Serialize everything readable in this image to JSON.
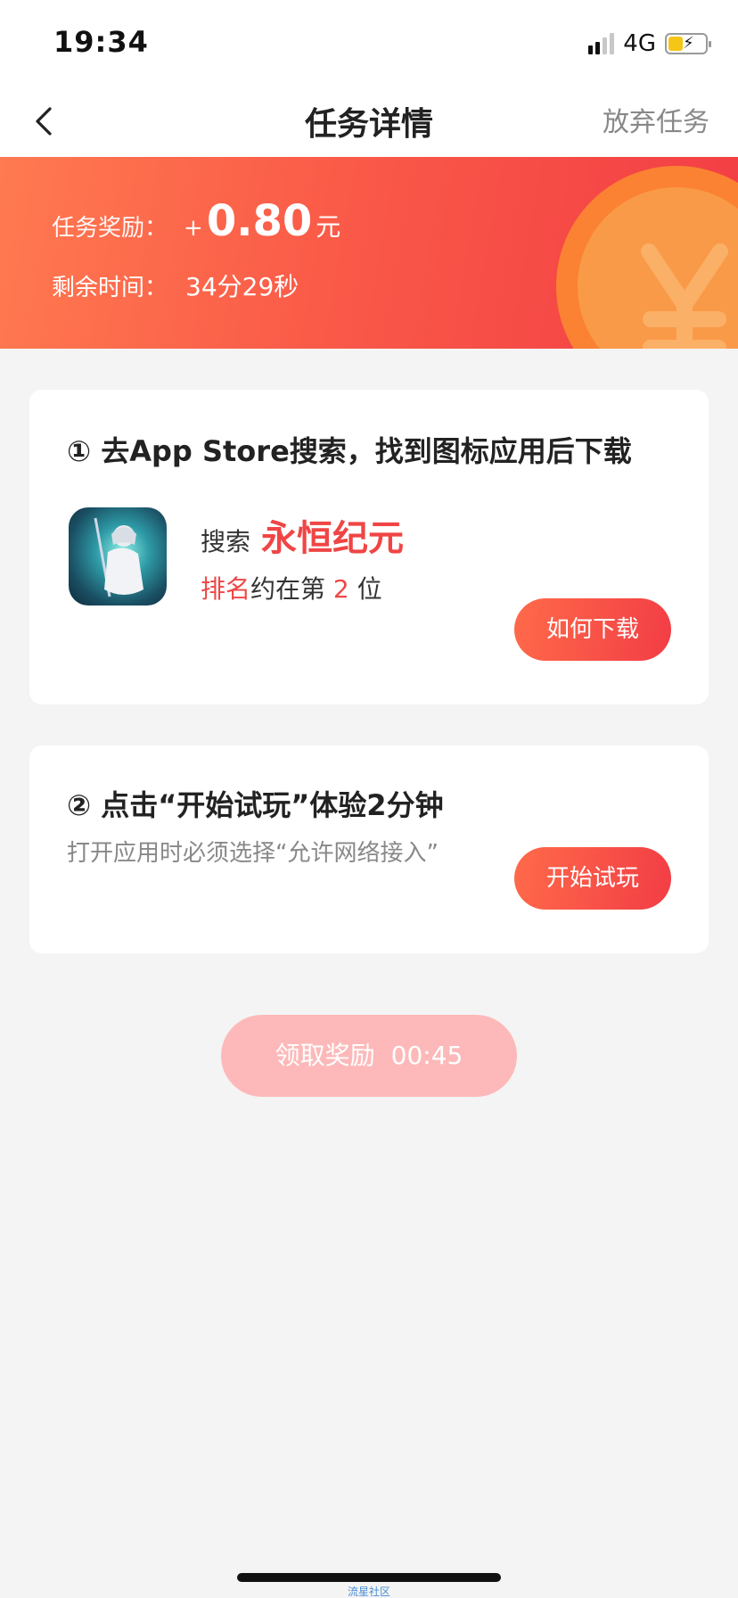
{
  "status_bar": {
    "time": "19:34",
    "network": "4G",
    "battery_color": "#f5c518"
  },
  "nav": {
    "title": "任务详情",
    "action_label": "放弃任务",
    "back_icon": "chevron-left-icon"
  },
  "banner": {
    "reward_label": "任务奖励：",
    "reward_plus": "+",
    "reward_amount": "0.80",
    "reward_unit": "元",
    "time_label": "剩余时间：",
    "time_value": "34分29秒",
    "coin_icon": "yen-coin-icon"
  },
  "step1": {
    "title": "① 去App Store搜索，找到图标应用后下载",
    "search_label": "搜索",
    "search_keyword": "永恒纪元",
    "rank_prefix_red": "排名",
    "rank_mid": "约在第 ",
    "rank_number": "2",
    "rank_suffix": " 位",
    "button_label": "如何下载"
  },
  "step2": {
    "title": "② 点击“开始试玩”体验2分钟",
    "note": "打开应用时必须选择“允许网络接入”",
    "button_label": "开始试玩"
  },
  "claim": {
    "label": "领取奖励",
    "countdown": "00:45"
  },
  "watermark": "流星社区",
  "colors": {
    "accent": "#f23d45",
    "banner_start": "#ff7a50",
    "page_bg": "#f4f4f4",
    "claim_disabled": "#fdb9b9"
  }
}
